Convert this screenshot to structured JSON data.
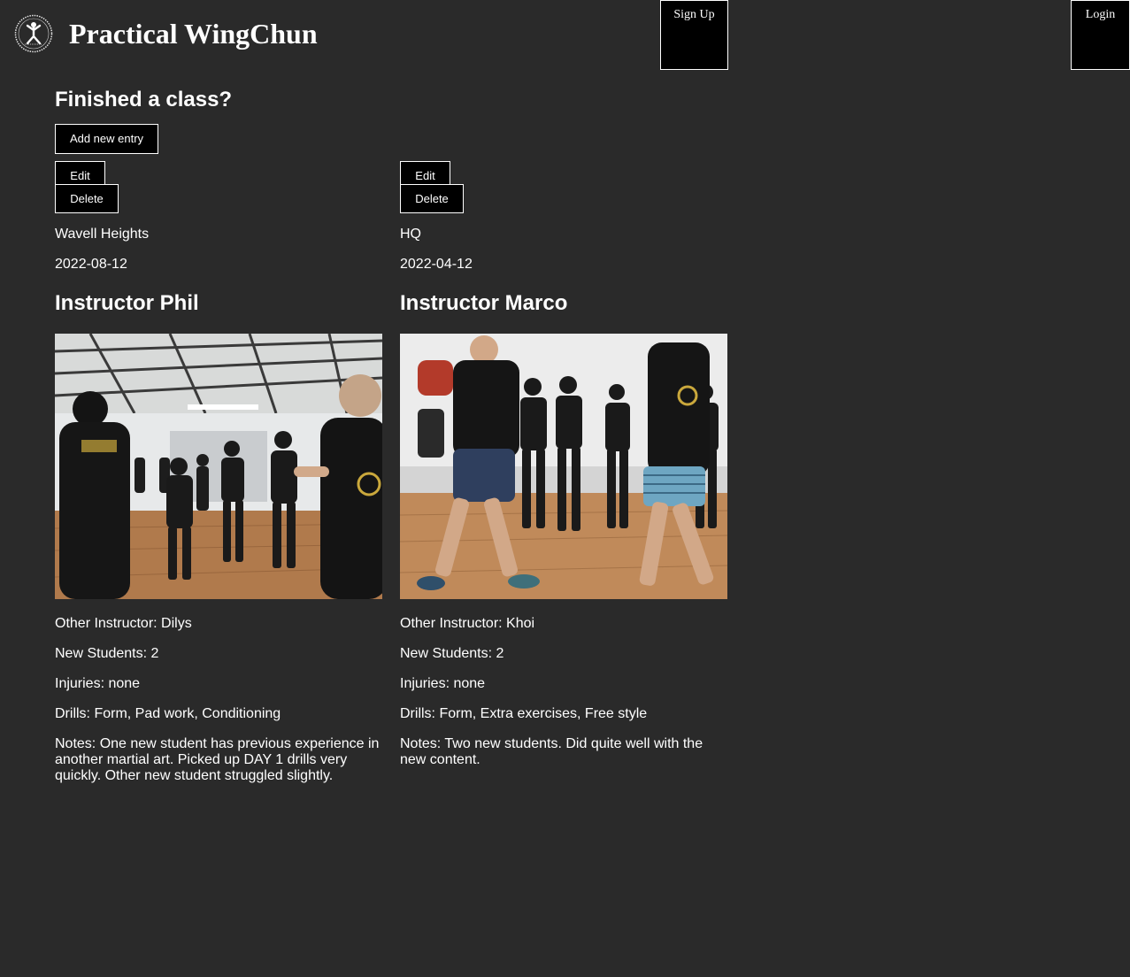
{
  "header": {
    "brand_name": "Practical WingChun",
    "signup_label": "Sign Up",
    "login_label": "Login",
    "logo_icon": "wingchun-logo-icon"
  },
  "main": {
    "heading": "Finished a class?",
    "add_label": "Add new entry"
  },
  "entries": [
    {
      "edit_label": "Edit",
      "delete_label": "Delete",
      "location": "Wavell Heights",
      "date": "2022-08-12",
      "instructor": "Instructor Phil",
      "other_instructor": "Other Instructor: Dilys",
      "new_students": "New Students: 2",
      "injuries": "Injuries: none",
      "drills": "Drills: Form, Pad work, Conditioning",
      "notes": "Notes: One new student has previous experience in another martial art. Picked up DAY 1 drills very quickly. Other new student struggled slightly."
    },
    {
      "edit_label": "Edit",
      "delete_label": "Delete",
      "location": "HQ",
      "date": "2022-04-12",
      "instructor": "Instructor Marco",
      "other_instructor": "Other Instructor: Khoi",
      "new_students": "New Students: 2",
      "injuries": "Injuries: none",
      "drills": "Drills: Form, Extra exercises, Free style",
      "notes": "Notes: Two new students. Did quite well with the new content."
    }
  ],
  "colors": {
    "background": "#2a2a2a",
    "button_background": "#000000",
    "text": "#ffffff"
  }
}
